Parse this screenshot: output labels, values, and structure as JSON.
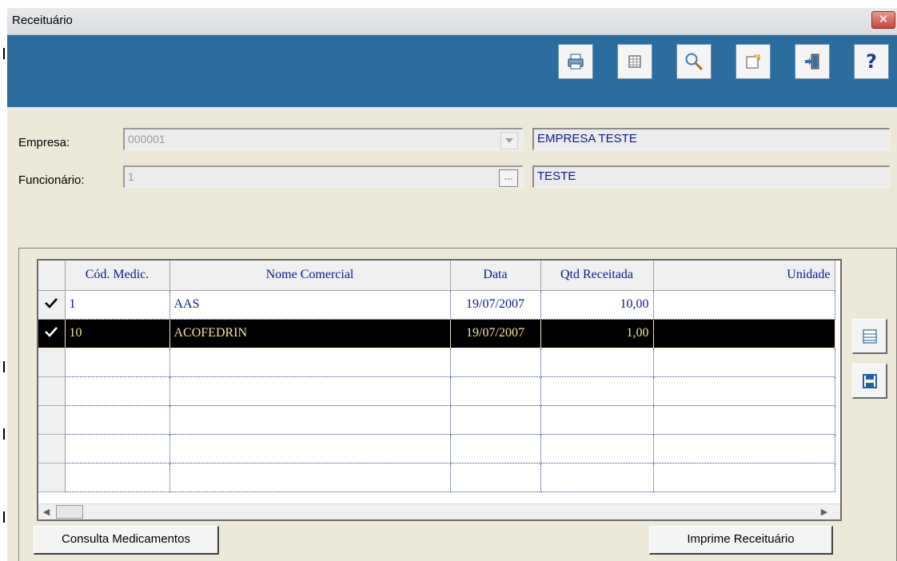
{
  "window": {
    "title": "Receituário",
    "close_label": "✕"
  },
  "toolbar": {
    "buttons": [
      {
        "name": "print-icon"
      },
      {
        "name": "grid-icon"
      },
      {
        "name": "search-icon"
      },
      {
        "name": "edit-note-icon"
      },
      {
        "name": "exit-door-icon"
      },
      {
        "name": "help-icon",
        "label": "?"
      }
    ]
  },
  "form": {
    "empresa": {
      "label": "Empresa:",
      "code": "000001",
      "name": "EMPRESA TESTE"
    },
    "funcionario": {
      "label": "Funcionário:",
      "code": "1",
      "name": "TESTE",
      "lookup_label": "..."
    }
  },
  "grid": {
    "columns": [
      "Cód. Medic.",
      "Nome Comercial",
      "Data",
      "Qtd Receitada",
      "Unidade"
    ],
    "rows": [
      {
        "checked": true,
        "selected": false,
        "cod": "1",
        "nome": "AAS",
        "data": "19/07/2007",
        "qtd": "10,00",
        "unidade": ""
      },
      {
        "checked": true,
        "selected": true,
        "cod": "10",
        "nome": "ACOFEDRIN",
        "data": "19/07/2007",
        "qtd": "1,00",
        "unidade": ""
      }
    ],
    "empty_rows": 5
  },
  "buttons": {
    "consulta": "Consulta Medicamentos",
    "imprime": "Imprime Receituário"
  },
  "colors": {
    "toolbar_bg": "#2b6d9e",
    "text_blue": "#0a1a8c",
    "selected_row_bg": "#000000",
    "selected_row_text": "#f3e79a"
  }
}
